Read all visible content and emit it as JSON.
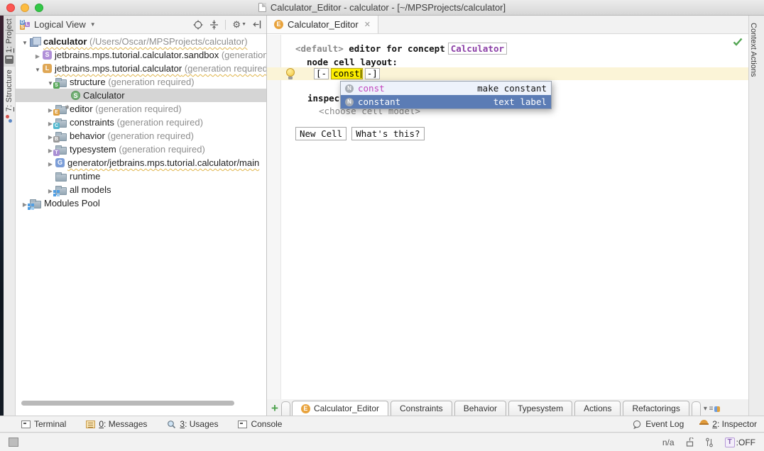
{
  "title_bar": {
    "title": "Calculator_Editor - calculator - [~/MPSProjects/calculator]"
  },
  "left_stripe": {
    "project_num": "1",
    "project_rest": ": Project",
    "structure_num": "7",
    "structure_rest": ": Structure"
  },
  "right_stripe": {
    "label": "Context Actions"
  },
  "project_panel": {
    "header": {
      "view": "Logical View"
    },
    "tree": [
      {
        "label": "calculator",
        "suffix": " (/Users/Oscar/MPSProjects/calculator)"
      },
      {
        "label": "jetbrains.mps.tutorial.calculator.sandbox",
        "suffix": " (generation required)"
      },
      {
        "label": "jetbrains.mps.tutorial.calculator",
        "suffix": " (generation required)"
      },
      {
        "label": "structure",
        "suffix": " (generation required)"
      },
      {
        "label": "Calculator",
        "suffix": ""
      },
      {
        "label": "editor",
        "suffix": " (generation required)"
      },
      {
        "label": "constraints",
        "suffix": " (generation required)"
      },
      {
        "label": "behavior",
        "suffix": " (generation required)"
      },
      {
        "label": "typesystem",
        "suffix": " (generation required)"
      },
      {
        "label": "generator/jetbrains.mps.tutorial.calculator/main",
        "suffix": ""
      },
      {
        "label": "runtime",
        "suffix": ""
      },
      {
        "label": "all models",
        "suffix": ""
      },
      {
        "label": "Modules Pool",
        "suffix": ""
      }
    ]
  },
  "editor": {
    "tab_label": "Calculator_Editor",
    "line_default": "<default>",
    "line_editor_for": " editor for concept",
    "concept": "Calculator",
    "node_cell_layout": "node cell layout:",
    "bracket_open": "[-",
    "cell_text": "const",
    "bracket_close": "-]",
    "inspected": "inspected cell layout:",
    "choose_cell": "<choose cell model>",
    "btn_new_cell": "New Cell",
    "btn_whats_this": "What's this?",
    "completion": [
      {
        "name": "const",
        "desc": "make constant"
      },
      {
        "name": "constant",
        "desc": "text label"
      }
    ]
  },
  "bottom_tabs": {
    "t0": "Calculator_Editor",
    "t1": "Constraints",
    "t2": "Behavior",
    "t3": "Typesystem",
    "t4": "Actions",
    "t5": "Refactorings"
  },
  "toolwindow_bar": {
    "terminal": "Terminal",
    "messages_num": "0",
    "messages_rest": ": Messages",
    "usages_num": "3",
    "usages_rest": ": Usages",
    "console": "Console",
    "event_log": "Event Log",
    "inspector_num": "2",
    "inspector_rest": ": Inspector"
  },
  "status_bar": {
    "na": "n/a",
    "t": "T",
    "t_state": ":OFF"
  },
  "colors": {
    "selection_blue": "#5b7cb5",
    "cell_highlight_yellow": "#fdee00",
    "line_highlight": "#fbf4d7",
    "concept_purple": "#8b3fa6",
    "completion_name_magenta": "#c244bd",
    "wavy_underline": "#e0b54b",
    "ok_check_green": "#53a553",
    "tab_icon_orange": "#e8a33d"
  }
}
